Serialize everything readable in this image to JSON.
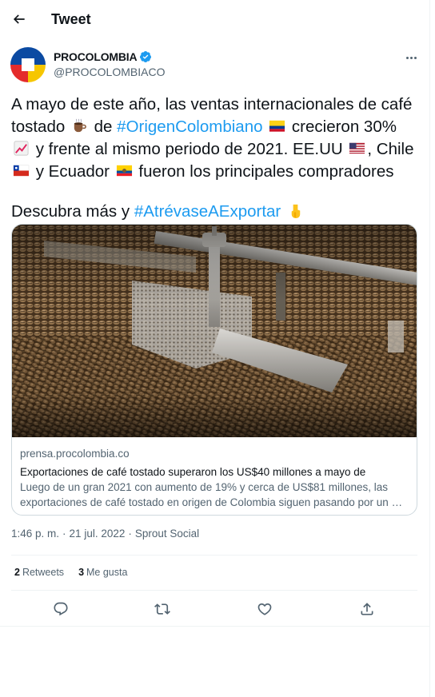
{
  "header": {
    "title": "Tweet"
  },
  "author": {
    "name": "PROCOLOMBIA",
    "handle": "@PROCOLOMBIACO"
  },
  "tweet": {
    "line1": "A mayo de este año, las ventas internacionales de café",
    "line2_a": "tostado",
    "line2_b": "de",
    "hashtag1": "#OrigenColombiano",
    "line2_c": "crecieron 30%",
    "line3_a": "y frente al mismo periodo de 2021. EE.UU",
    "line3_b": ", Chile",
    "line4_a": "y Ecuador",
    "line4_b": "fueron los principales compradores",
    "line5_a": "Descubra más y",
    "hashtag2": "#AtrévaseAExportar",
    "emojis": [
      "hot-beverage",
      "colombia-flag",
      "chart-increasing",
      "usa-flag",
      "chile-flag",
      "ecuador-flag",
      "pointing-down"
    ]
  },
  "card": {
    "image_alt": "coffee-roaster-beans",
    "domain": "prensa.procolombia.co",
    "title": "Exportaciones de café tostado superaron los US$40 millones a mayo de",
    "desc_line1": "Luego de un gran 2021 con aumento de 19% y cerca de US$81 millones, las",
    "desc_line2": "exportaciones de café tostado en origen de Colombia siguen pasando por un …"
  },
  "meta": {
    "time": "1:46 p. m.",
    "sep": "·",
    "date": "21 jul. 2022",
    "source": "Sprout Social"
  },
  "stats": {
    "retweets_count": "2",
    "retweets_label": "Retweets",
    "likes_count": "3",
    "likes_label": "Me gusta"
  },
  "colors": {
    "accent": "#1d9bf0",
    "text": "#0f1419",
    "muted": "#536471",
    "border": "#cfd9de"
  }
}
